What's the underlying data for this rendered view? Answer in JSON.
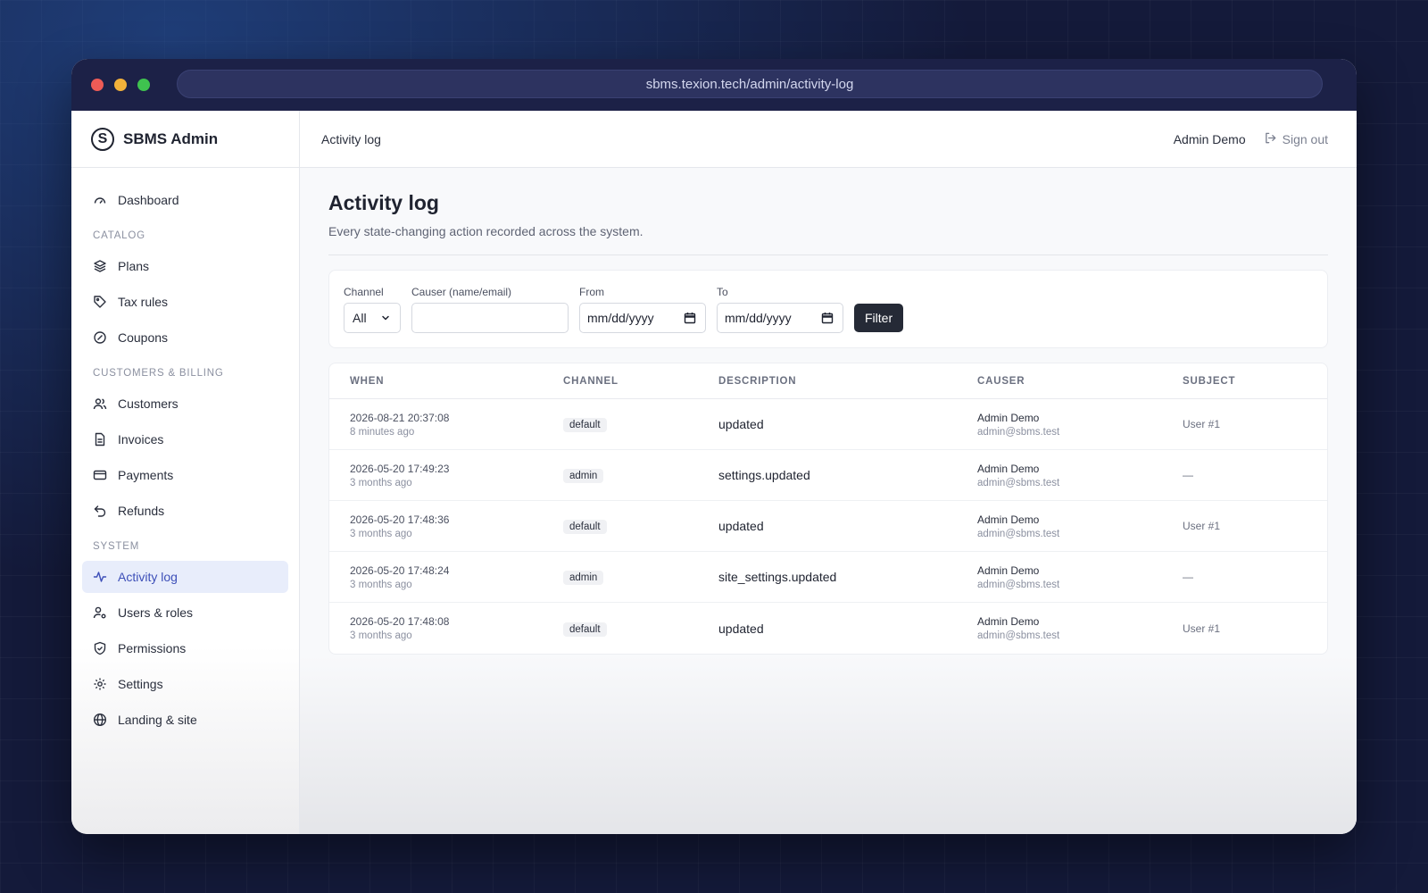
{
  "browser": {
    "url": "sbms.texion.tech/admin/activity-log"
  },
  "sidebar": {
    "brand": "SBMS Admin",
    "dashboard": "Dashboard",
    "sections": {
      "catalog": "CATALOG",
      "billing": "CUSTOMERS & BILLING",
      "system": "SYSTEM"
    },
    "items": {
      "plans": "Plans",
      "tax_rules": "Tax rules",
      "coupons": "Coupons",
      "customers": "Customers",
      "invoices": "Invoices",
      "payments": "Payments",
      "refunds": "Refunds",
      "activity_log": "Activity log",
      "users_roles": "Users & roles",
      "permissions": "Permissions",
      "settings": "Settings",
      "landing_site": "Landing & site"
    }
  },
  "topbar": {
    "title": "Activity log",
    "user": "Admin Demo",
    "signout": "Sign out"
  },
  "page": {
    "title": "Activity log",
    "subtitle": "Every state-changing action recorded across the system."
  },
  "filters": {
    "channel_label": "Channel",
    "channel_value": "All",
    "causer_label": "Causer (name/email)",
    "causer_value": "",
    "from_label": "From",
    "from_placeholder": "mm/dd/yyyy",
    "to_label": "To",
    "to_placeholder": "mm/dd/yyyy",
    "button": "Filter"
  },
  "table": {
    "headers": {
      "when": "WHEN",
      "channel": "CHANNEL",
      "description": "DESCRIPTION",
      "causer": "CAUSER",
      "subject": "SUBJECT"
    },
    "rows": [
      {
        "date": "2026-08-21 20:37:08",
        "ago": "8 minutes ago",
        "channel": "default",
        "description": "updated",
        "causer_name": "Admin Demo",
        "causer_email": "admin@sbms.test",
        "subject": "User #1"
      },
      {
        "date": "2026-05-20 17:49:23",
        "ago": "3 months ago",
        "channel": "admin",
        "description": "settings.updated",
        "causer_name": "Admin Demo",
        "causer_email": "admin@sbms.test",
        "subject": "—"
      },
      {
        "date": "2026-05-20 17:48:36",
        "ago": "3 months ago",
        "channel": "default",
        "description": "updated",
        "causer_name": "Admin Demo",
        "causer_email": "admin@sbms.test",
        "subject": "User #1"
      },
      {
        "date": "2026-05-20 17:48:24",
        "ago": "3 months ago",
        "channel": "admin",
        "description": "site_settings.updated",
        "causer_name": "Admin Demo",
        "causer_email": "admin@sbms.test",
        "subject": "—"
      },
      {
        "date": "2026-05-20 17:48:08",
        "ago": "3 months ago",
        "channel": "default",
        "description": "updated",
        "causer_name": "Admin Demo",
        "causer_email": "admin@sbms.test",
        "subject": "User #1"
      }
    ]
  },
  "colors": {
    "accent": "#3d4fb8",
    "active_bg": "#e8edfb",
    "button_dark": "#252a36"
  }
}
